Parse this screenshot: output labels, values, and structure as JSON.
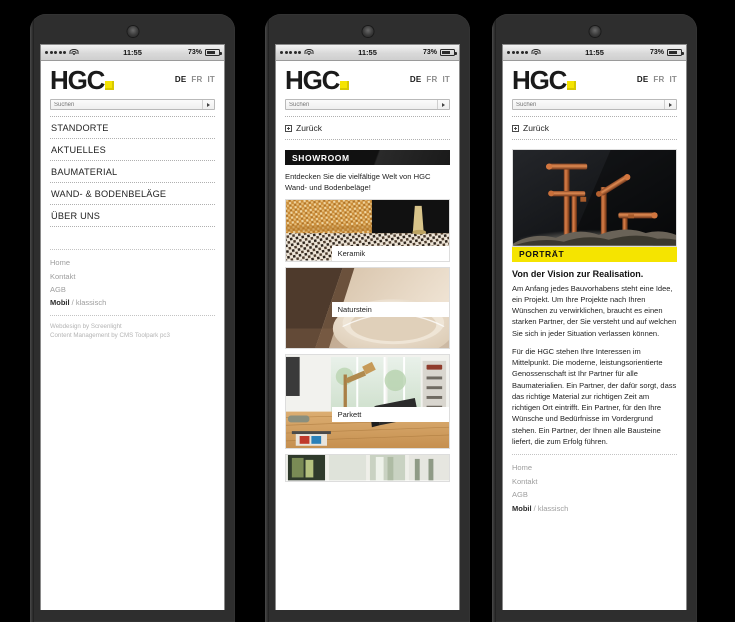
{
  "statusbar": {
    "time": "11:55",
    "battery": "73%",
    "signal_dots": 5
  },
  "brand": {
    "logo_text": "HGC",
    "cube_color": "#f5e400"
  },
  "languages": [
    {
      "code": "DE",
      "active": true
    },
    {
      "code": "FR",
      "active": false
    },
    {
      "code": "IT",
      "active": false
    }
  ],
  "search": {
    "placeholder": "Suchen",
    "value": ""
  },
  "phone1": {
    "nav": [
      {
        "label": "STANDORTE"
      },
      {
        "label": "AKTUELLES"
      },
      {
        "label": "BAUMATERIAL"
      },
      {
        "label": "WAND- & BODENBELÄGE"
      },
      {
        "label": "ÜBER UNS"
      }
    ],
    "footer_links": [
      {
        "label": "Home"
      },
      {
        "label": "Kontakt"
      },
      {
        "label": "AGB"
      }
    ],
    "mobile_toggle": {
      "active": "Mobil",
      "separator": " / ",
      "inactive": "klassisch"
    },
    "credits": [
      "Webdesign by Screenlight",
      "Content Management by CMS Toolpark pc3"
    ]
  },
  "phone2": {
    "back_label": "Zurück",
    "banner": "SHOWROOM",
    "intro": "Entdecken Sie die vielfältige Welt von HGC Wand- und Bodenbeläge!",
    "tiles": [
      {
        "caption": "Keramik"
      },
      {
        "caption": "Naturstein"
      },
      {
        "caption": "Parkett"
      }
    ]
  },
  "phone3": {
    "back_label": "Zurück",
    "banner": "PORTRÄT",
    "heading": "Von der Vision zur Realisation.",
    "paragraphs": [
      "Am Anfang jedes Bauvorhabens steht eine Idee, ein Projekt. Um Ihre Projekte nach Ihren Wünschen zu verwirklichen, braucht es einen starken Partner, der Sie versteht und auf welchen Sie sich in jeder Situation verlassen können.",
      "Für die HGC stehen Ihre Interessen im Mittelpunkt. Die moderne, leistungsorientierte Genossenschaft ist Ihr Partner für alle Baumaterialien. Ein Partner, der dafür sorgt, dass das richtige Material zur richtigen Zeit am richtigen Ort eintrifft. Ein Partner, für den Ihre Wünsche und Bedürfnisse im Vordergrund stehen. Ein Partner, der Ihnen alle Bausteine liefert, die zum Erfolg führen."
    ],
    "footer_links": [
      {
        "label": "Home"
      },
      {
        "label": "Kontakt"
      },
      {
        "label": "AGB"
      }
    ],
    "mobile_toggle": {
      "active": "Mobil",
      "separator": " / ",
      "inactive": "klassisch"
    }
  }
}
